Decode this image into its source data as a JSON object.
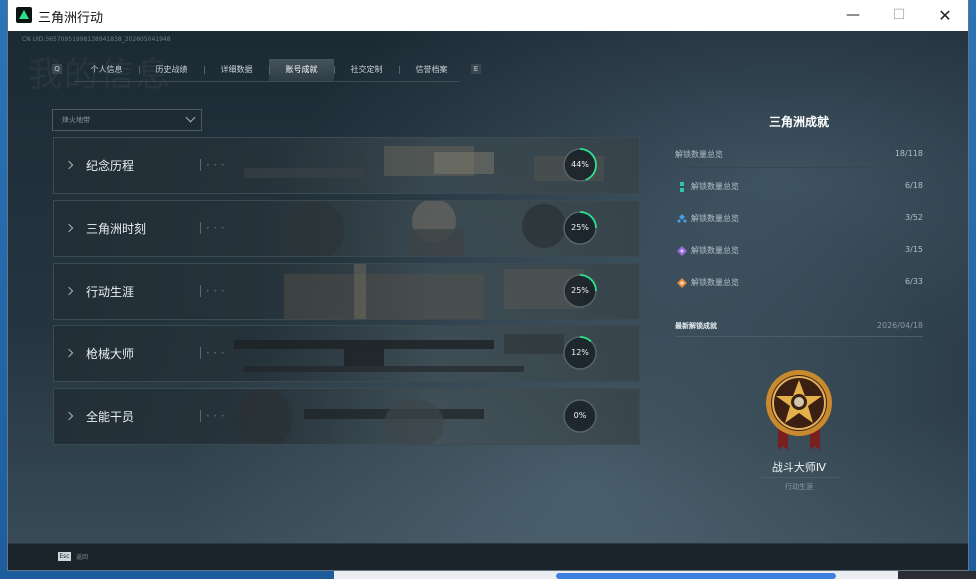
{
  "window": {
    "app_title": "三角洲行动",
    "min_label": "—",
    "max_label": "☐",
    "close_label": "✕"
  },
  "header": {
    "uid_text": "CN UID:36570951998138941838_202605041948",
    "bg_text": "我的信息"
  },
  "nav": {
    "prev_key": "Q",
    "next_key": "E",
    "tabs": [
      {
        "label": "个人信息",
        "active": false
      },
      {
        "label": "历史战绩",
        "active": false
      },
      {
        "label": "详细数据",
        "active": false
      },
      {
        "label": "账号成就",
        "active": true
      },
      {
        "label": "社交定制",
        "active": false
      },
      {
        "label": "信誉档案",
        "active": false
      }
    ]
  },
  "filter": {
    "selected": "烽火地带"
  },
  "categories": [
    {
      "title": "纪念历程",
      "percent": 44,
      "percent_label": "44%"
    },
    {
      "title": "三角洲时刻",
      "percent": 25,
      "percent_label": "25%"
    },
    {
      "title": "行动生涯",
      "percent": 25,
      "percent_label": "25%"
    },
    {
      "title": "枪械大师",
      "percent": 12,
      "percent_label": "12%"
    },
    {
      "title": "全能干员",
      "percent": 0,
      "percent_label": "0%"
    }
  ],
  "panel": {
    "title": "三角洲成就",
    "summary": {
      "label": "解锁数量总览",
      "count": "18/118"
    },
    "stats": [
      {
        "icon": "teal-rank-icon",
        "label": "解锁数量总览",
        "count": "6/18",
        "color": "#2fc5a6"
      },
      {
        "icon": "blue-rank-icon",
        "label": "解锁数量总览",
        "count": "3/52",
        "color": "#4c9ce0"
      },
      {
        "icon": "purple-rank-icon",
        "label": "解锁数量总览",
        "count": "3/15",
        "color": "#9a6ae0"
      },
      {
        "icon": "orange-rank-icon",
        "label": "解锁数量总览",
        "count": "6/33",
        "color": "#e08a3c"
      }
    ],
    "latest": {
      "label": "最新解锁成就",
      "date": "2026/04/18"
    },
    "medal": {
      "name": "战斗大师Ⅳ",
      "category": "行动生涯"
    }
  },
  "footer": {
    "esc_key": "Esc",
    "esc_label": "返回"
  },
  "colors": {
    "accent": "#2ee08b",
    "ring_track": "#55636b"
  }
}
